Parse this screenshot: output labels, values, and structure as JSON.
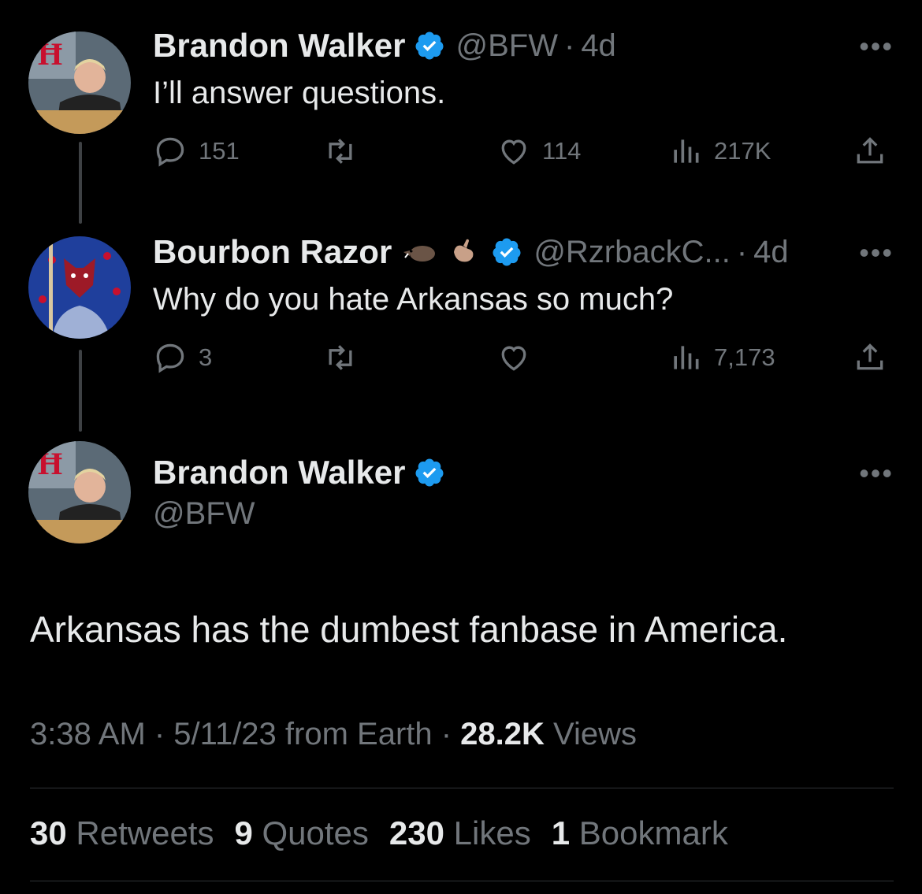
{
  "tweets": [
    {
      "name": "Brandon Walker",
      "handle": "@BFW",
      "time": "4d",
      "text": "I’ll answer questions.",
      "replies": "151",
      "retweets": "",
      "likes": "114",
      "views": "217K"
    },
    {
      "name": "Bourbon Razor",
      "emoji": [
        "boar-emoji",
        "call-me-hand-emoji"
      ],
      "handle": "@RzrbackC...",
      "time": "4d",
      "text": "Why do you hate Arkansas so much?",
      "replies": "3",
      "retweets": "",
      "likes": "",
      "views": "7,173"
    }
  ],
  "main": {
    "name": "Brandon Walker",
    "handle": "@BFW",
    "text": "Arkansas has the dumbest fanbase in America.",
    "timestamp": "3:38 AM · 5/11/23 from Earth · ",
    "views_count": "28.2K",
    "views_label": " Views",
    "stats": [
      {
        "count": "30",
        "label": "Retweets"
      },
      {
        "count": "9",
        "label": "Quotes"
      },
      {
        "count": "230",
        "label": "Likes"
      },
      {
        "count": "1",
        "label": "Bookmark"
      }
    ]
  },
  "more_label": "•••",
  "dot": "·",
  "colors": {
    "background": "#000000",
    "primary_text": "#e7e9ea",
    "secondary_text": "#71767b",
    "verified": "#1d9bf0"
  }
}
